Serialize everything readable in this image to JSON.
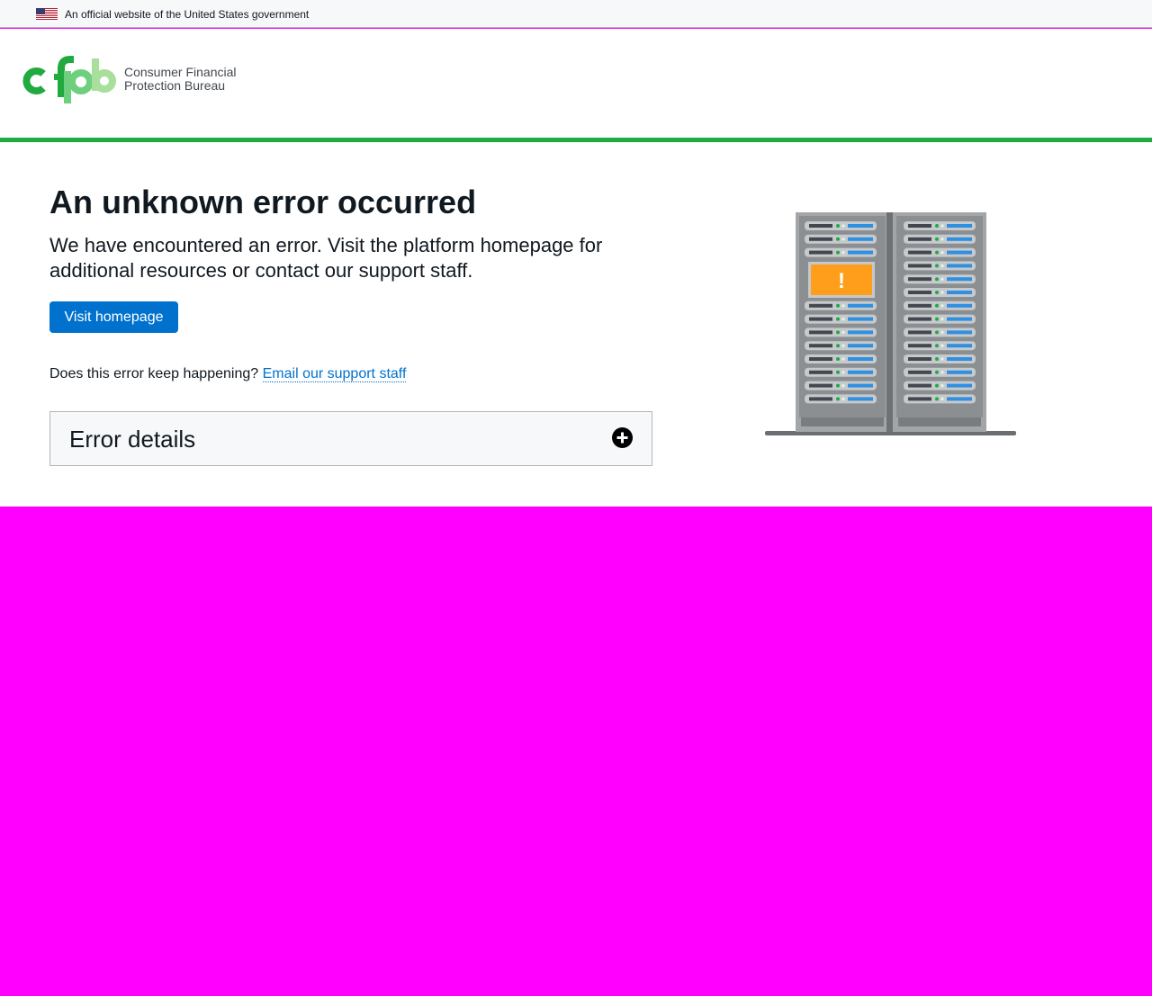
{
  "gov_banner": {
    "text": "An official website of the United States government",
    "flag_icon": "us-flag-icon"
  },
  "header": {
    "logo_mark": "cfpb",
    "logo_name_line1": "Consumer Financial",
    "logo_name_line2": "Protection Bureau",
    "accent_color": "#20aa3f"
  },
  "main": {
    "title": "An unknown error occurred",
    "lead": "We have encountered an error. Visit the platform homepage for additional resources or contact our support staff.",
    "homepage_button": "Visit homepage",
    "help_prefix": "Does this error keep happening?",
    "help_link": "Email our support staff",
    "expandable_label": "Error details",
    "expandable_icon": "plus-circle-icon",
    "illustration_icon": "server-rack-warning-icon",
    "warning_glyph": "!"
  },
  "colors": {
    "primary_button": "#0072ce",
    "link": "#0072ce",
    "warning": "#ff9e1b",
    "below_fold": "#ff00ff"
  }
}
